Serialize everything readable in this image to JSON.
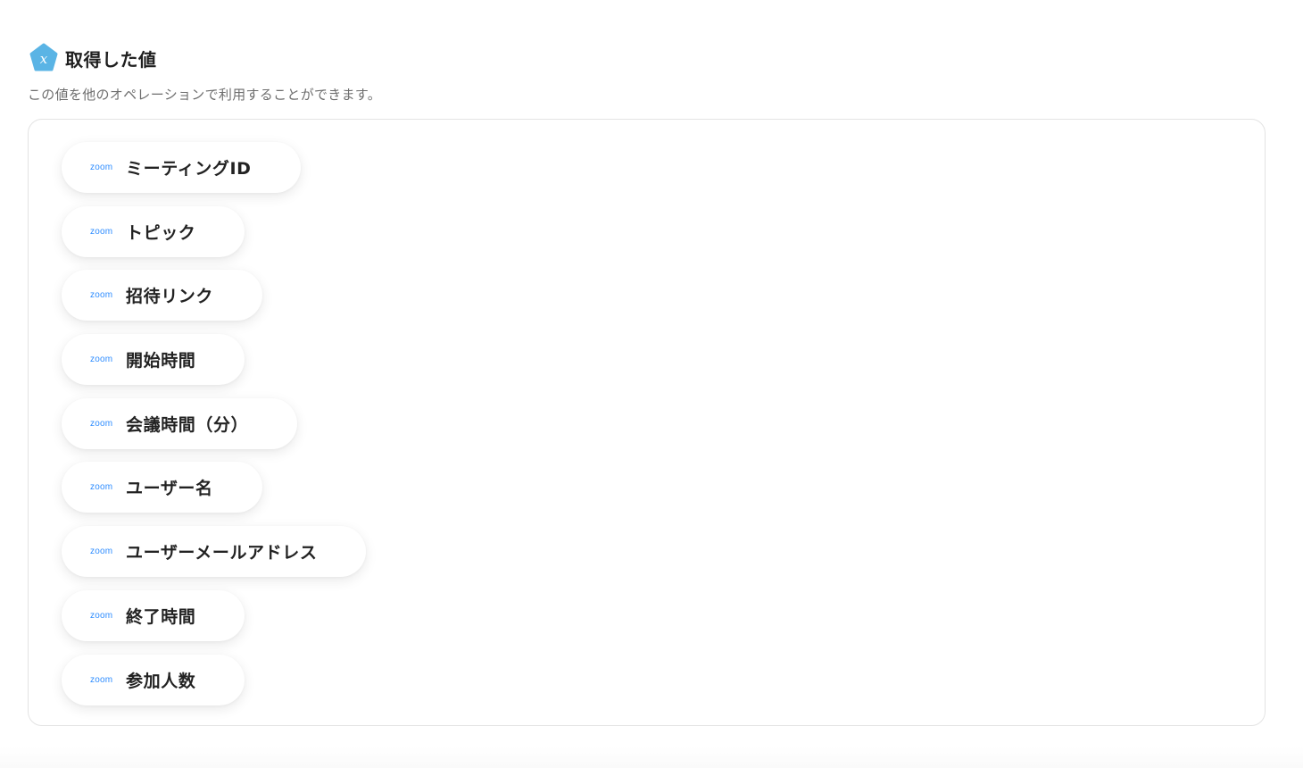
{
  "header": {
    "title": "取得した値",
    "description": "この値を他のオペレーションで利用することができます。",
    "icon_color": "#5ab4e5"
  },
  "values": {
    "source_label": "zoom",
    "accent_color": "#2d8cff",
    "items": [
      {
        "label": "ミーティングID"
      },
      {
        "label": "トピック"
      },
      {
        "label": "招待リンク"
      },
      {
        "label": "開始時間"
      },
      {
        "label": "会議時間（分）"
      },
      {
        "label": "ユーザー名"
      },
      {
        "label": "ユーザーメールアドレス"
      },
      {
        "label": "終了時間"
      },
      {
        "label": "参加人数"
      }
    ]
  }
}
